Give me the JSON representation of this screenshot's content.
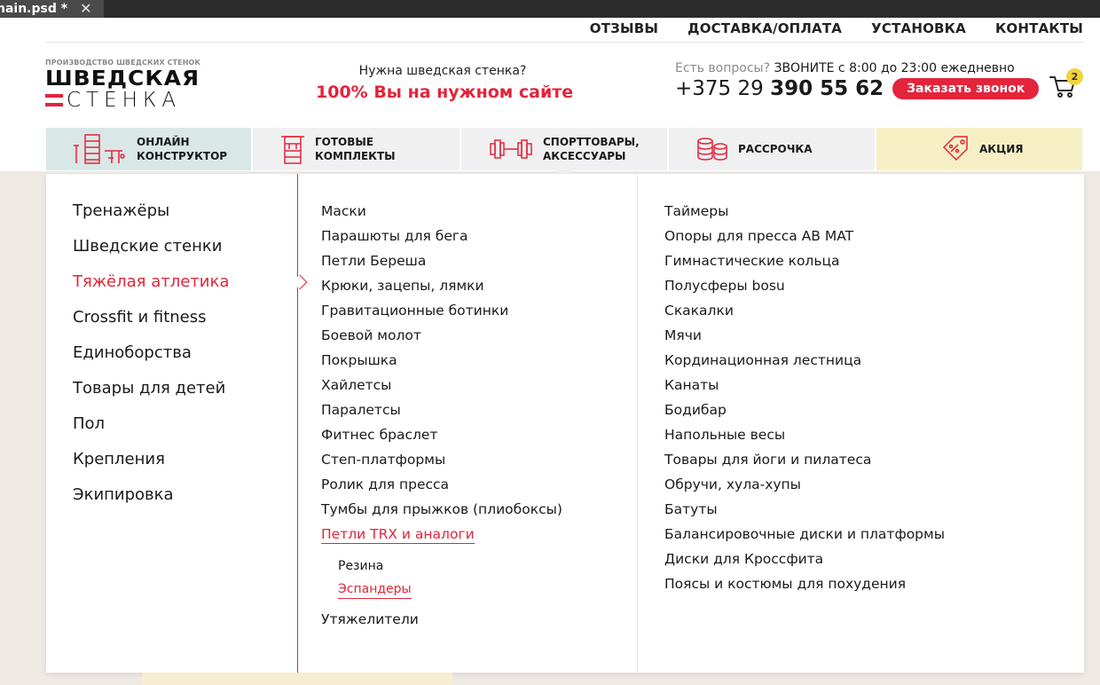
{
  "window": {
    "tab_title": "nain.psd *",
    "close_glyph": "✕"
  },
  "topnav": [
    "ОТЗЫВЫ",
    "ДОСТАВКА/ОПЛАТА",
    "УСТАНОВКА",
    "КОНТАКТЫ"
  ],
  "logo": {
    "subtitle": "ПРОИЗВОДСТВО ШВЕДСКИХ СТЕНОК",
    "line1": "ШВЕДСКАЯ",
    "line2": "СТЕНКА"
  },
  "slogan": {
    "line1": "Нужна шведская стенка?",
    "line2": "100% Вы на нужном сайте"
  },
  "contact": {
    "question": "Есть вопросы?",
    "hours": "ЗВОНИТЕ с 8:00 до 23:00 ежедневно",
    "phone_prefix": "+375 29",
    "phone_number": "390 55 62",
    "callback_button": "Заказать звонок"
  },
  "cart": {
    "count": "2"
  },
  "mainnav": [
    {
      "label": "ОНЛАЙН\nКОНСТРУКТОР",
      "icon": "wall-bars-icon",
      "bg": "#d9e8e6"
    },
    {
      "label": "ГОТОВЫЕ\nКОМПЛЕКТЫ",
      "icon": "sports-complex-icon",
      "bg": "#f0f0f0"
    },
    {
      "label": "СПОРТТОВАРЫ,\nАКСЕССУАРЫ",
      "icon": "dumbbell-icon",
      "bg": "#f0f0f0"
    },
    {
      "label": "РАССРОЧКА",
      "icon": "coins-icon",
      "bg": "#f0f0f0"
    },
    {
      "label": "АКЦИЯ",
      "icon": "discount-tag-icon",
      "bg": "#f7efc4"
    }
  ],
  "categories": [
    "Тренажёры",
    "Шведские стенки",
    "Тяжёлая атлетика",
    "Crossfit и fitness",
    "Единоборства",
    "Товары для детей",
    "Пол",
    "Крепления",
    "Экипировка"
  ],
  "active_category": "Тяжёлая атлетика",
  "column2": [
    "Маски",
    "Парашюты для бега",
    "Петли Береша",
    "Крюки, зацепы, лямки",
    "Гравитационные ботинки",
    "Боевой молот",
    "Покрышка",
    "Хайлетсы",
    "Паралетсы",
    "Фитнес браслет",
    "Степ-платформы",
    "Ролик для пресса",
    "Тумбы для прыжков (плиобоксы)",
    "Петли TRX и аналоги"
  ],
  "column2_sub": [
    "Резина",
    "Эспандеры"
  ],
  "column2_after": "Утяжелители",
  "column3": [
    "Таймеры",
    "Опоры для пресса AB MAT",
    "Гимнастические кольца",
    "Полусферы bosu",
    "Скакалки",
    "Мячи",
    "Кординационная лестница",
    "Канаты",
    "Бодибар",
    "Напольные весы",
    "Товары для йоги и пилатеса",
    "Обручи, хула-хупы",
    "Батуты",
    "Балансировочные диски и платформы",
    "Диски для Кроссфита",
    "Поясы и костюмы для похудения"
  ],
  "colors": {
    "accent": "#e3243b",
    "badge": "#f3d23c"
  }
}
